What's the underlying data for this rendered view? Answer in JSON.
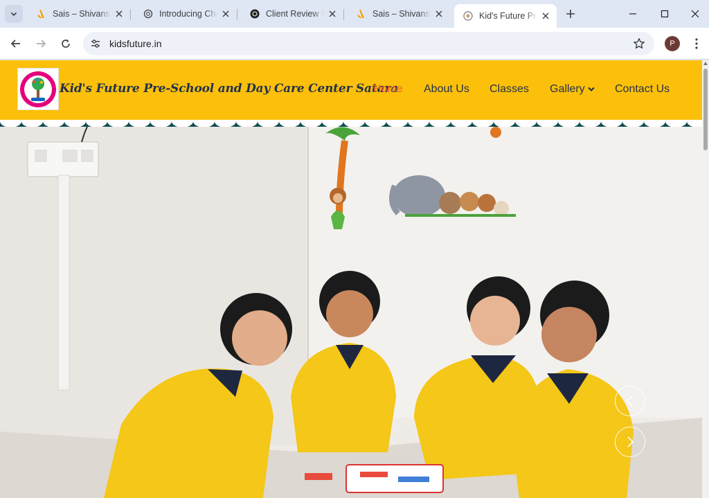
{
  "browser": {
    "tabs": [
      {
        "title": "Sais – Shivansh",
        "favicon": "sais-icon"
      },
      {
        "title": "Introducing ChatGPT",
        "favicon": "openai-icon"
      },
      {
        "title": "Client Review Summary",
        "favicon": "openai-icon"
      },
      {
        "title": "Sais – Shivansh",
        "favicon": "sais-icon"
      },
      {
        "title": "Kid's Future Pre-School",
        "favicon": "globe-icon",
        "active": true
      }
    ],
    "url": "kidsfuture.in",
    "profile_initial": "P"
  },
  "site": {
    "brand_name": "Kid's Future Pre-School and Day Care Center Satara",
    "nav": [
      {
        "label": "Home",
        "active": true
      },
      {
        "label": "About Us"
      },
      {
        "label": "Classes"
      },
      {
        "label": "Gallery",
        "has_dropdown": true
      },
      {
        "label": "Contact Us"
      }
    ],
    "colors": {
      "header_bg": "#fcc00a",
      "nav_text": "#24324a",
      "nav_active": "#f25c2b",
      "scallop_band": "#0e4d53"
    },
    "hero": {
      "image": "children-playing-in-classroom",
      "controls": [
        "chevron-left-icon",
        "chevron-right-icon"
      ]
    }
  }
}
